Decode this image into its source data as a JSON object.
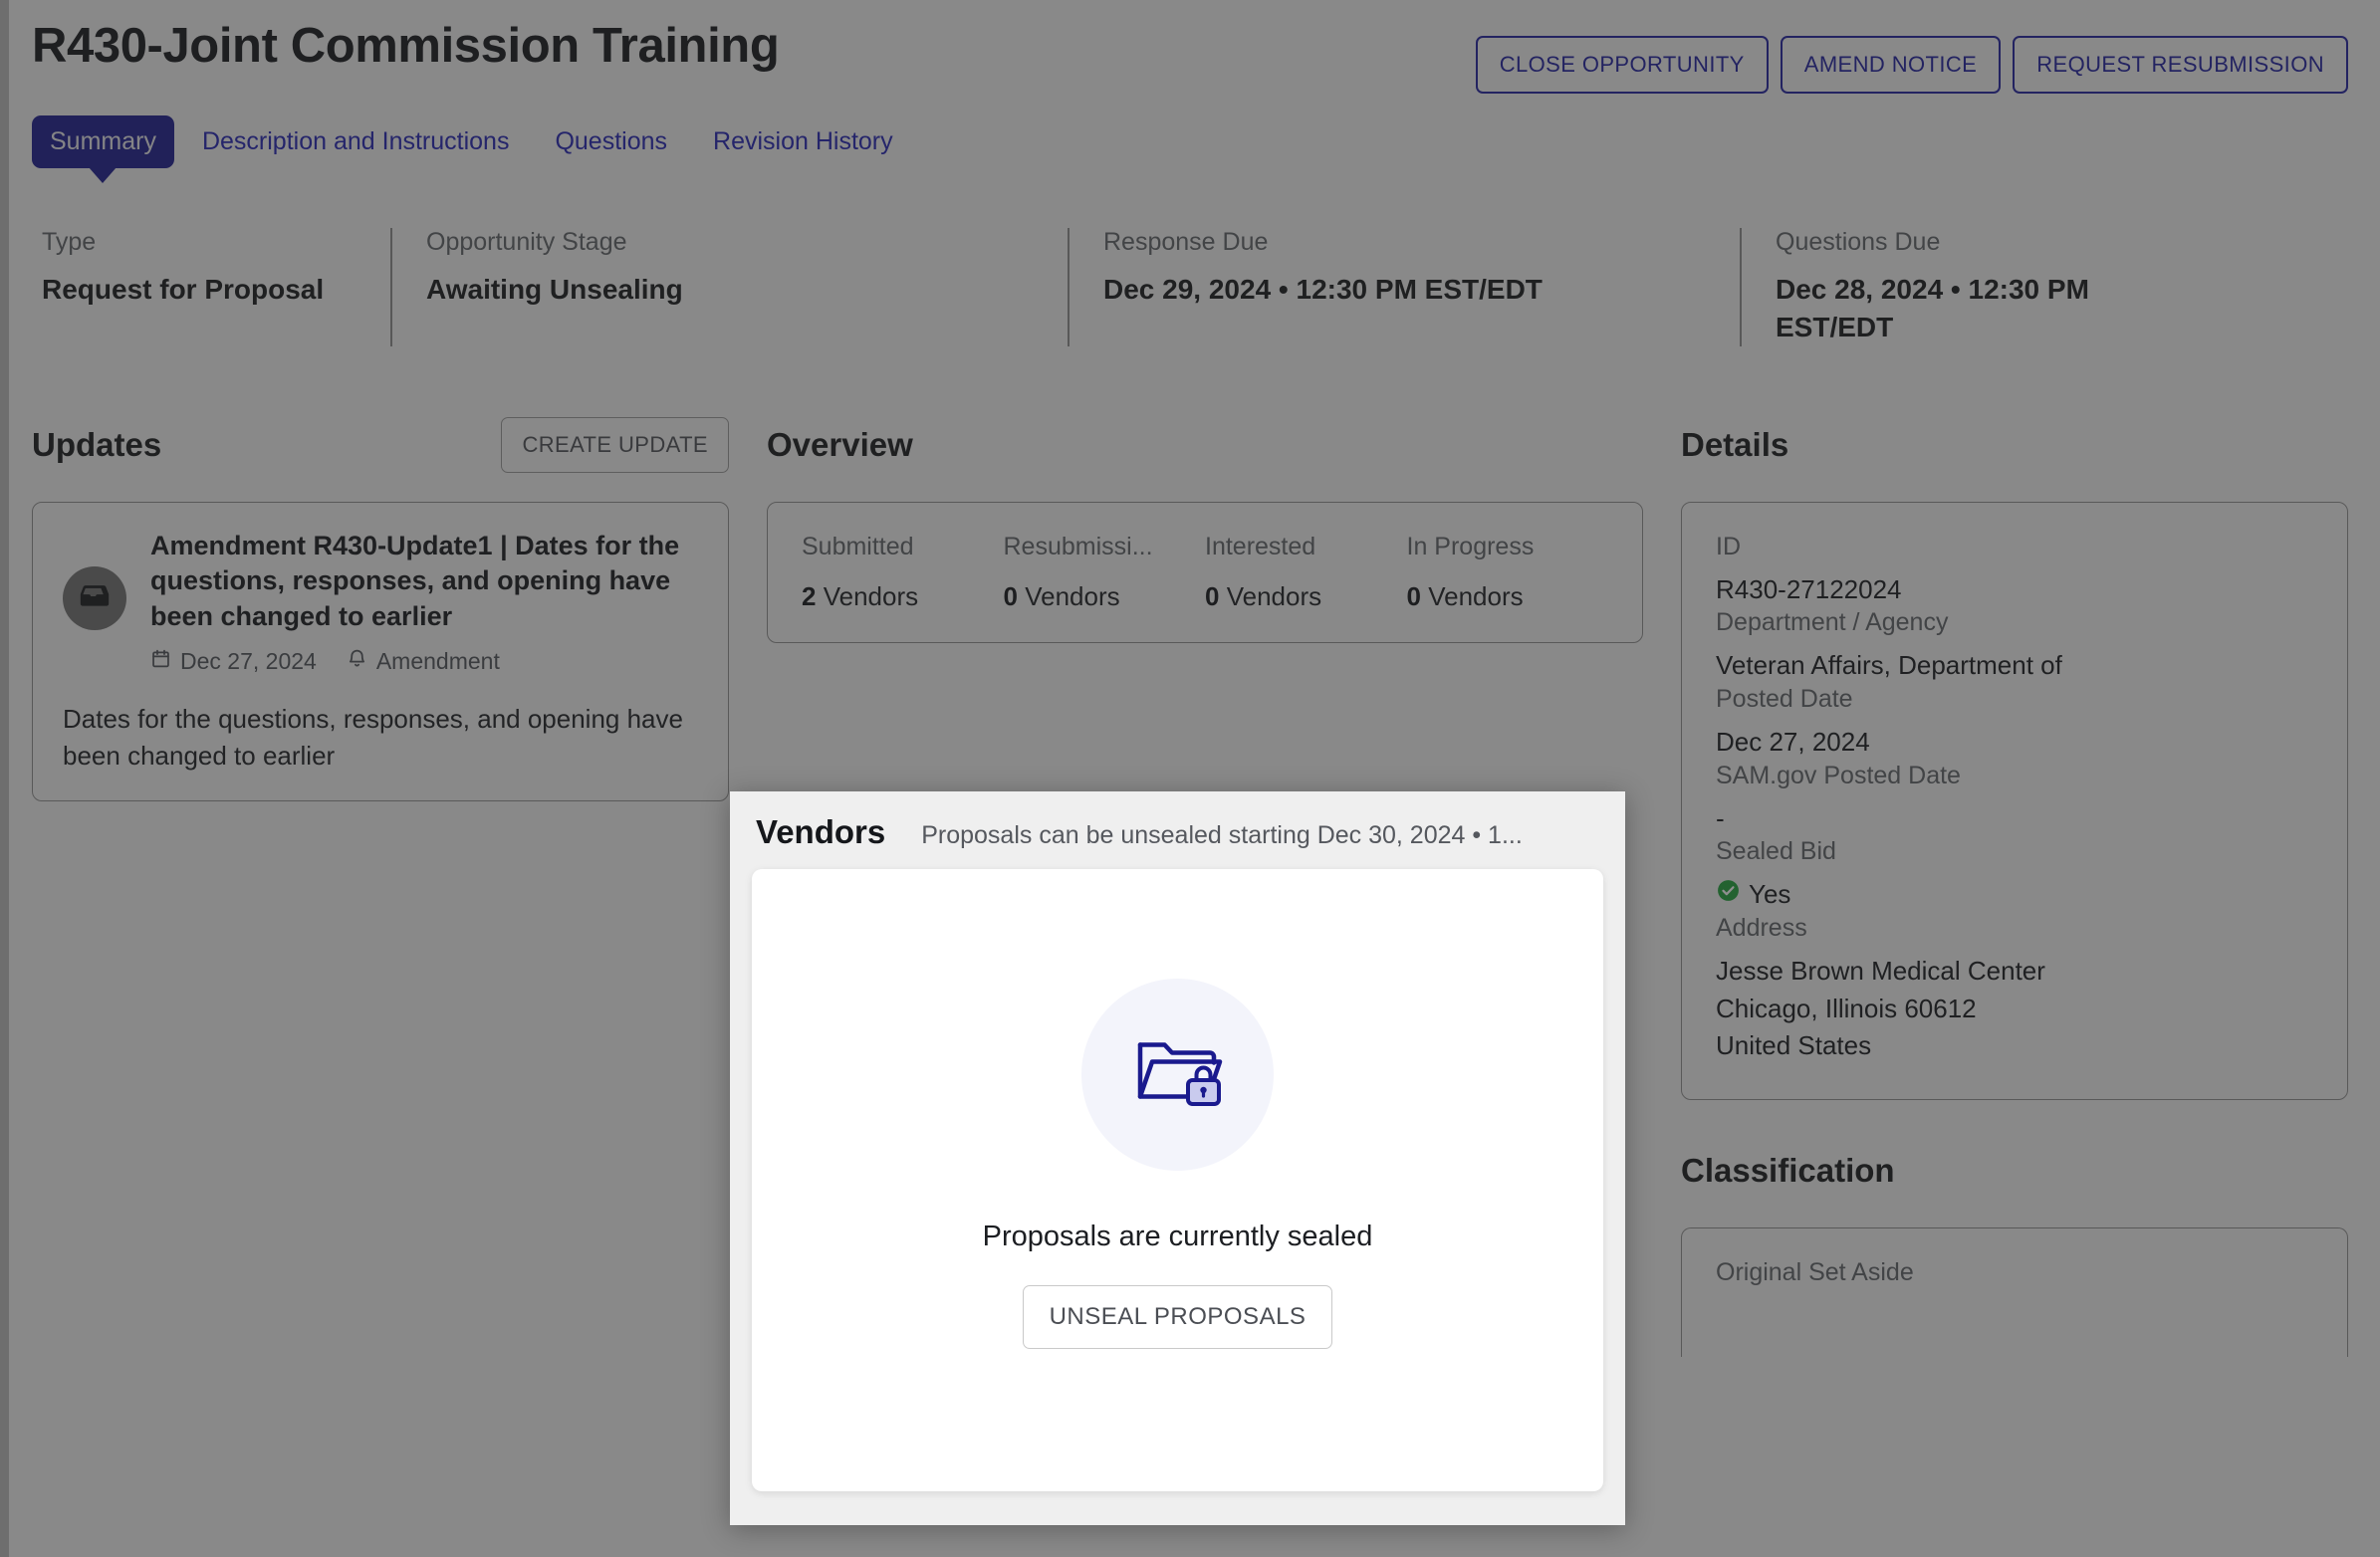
{
  "header": {
    "title": "R430-Joint Commission Training",
    "actions": [
      {
        "label": "CLOSE OPPORTUNITY",
        "name": "close-opportunity-button"
      },
      {
        "label": "AMEND NOTICE",
        "name": "amend-notice-button"
      },
      {
        "label": "REQUEST RESUBMISSION",
        "name": "request-resubmission-button"
      }
    ]
  },
  "tabs": [
    {
      "label": "Summary",
      "active": true
    },
    {
      "label": "Description and Instructions",
      "active": false
    },
    {
      "label": "Questions",
      "active": false
    },
    {
      "label": "Revision History",
      "active": false
    }
  ],
  "info_strip": [
    {
      "label": "Type",
      "value": "Request for Proposal"
    },
    {
      "label": "Opportunity Stage",
      "value": "Awaiting Unsealing"
    },
    {
      "label": "Response Due",
      "value": "Dec 29, 2024 • 12:30 PM EST/EDT"
    },
    {
      "label": "Questions Due",
      "value": "Dec 28, 2024 • 12:30 PM EST/EDT"
    }
  ],
  "updates": {
    "title": "Updates",
    "create_label": "CREATE UPDATE",
    "items": [
      {
        "icon": "inbox-icon",
        "title": "Amendment R430-Update1 | Dates for the questions, responses, and opening have been changed to earlier",
        "date": "Dec 27, 2024",
        "tag": "Amendment",
        "body": "Dates for the questions, responses, and opening have been changed to earlier"
      }
    ]
  },
  "overview": {
    "title": "Overview",
    "stats": [
      {
        "label": "Submitted",
        "count": "2",
        "unit": "Vendors"
      },
      {
        "label": "Resubmissi...",
        "count": "0",
        "unit": "Vendors"
      },
      {
        "label": "Interested",
        "count": "0",
        "unit": "Vendors"
      },
      {
        "label": "In Progress",
        "count": "0",
        "unit": "Vendors"
      }
    ]
  },
  "vendors_modal": {
    "title": "Vendors",
    "subtitle": "Proposals can be unsealed starting Dec 30, 2024 • 1...",
    "sealed_message": "Proposals are currently sealed",
    "unseal_label": "UNSEAL PROPOSALS",
    "icon": "folder-lock-icon"
  },
  "details": {
    "title": "Details",
    "fields": [
      {
        "label": "ID",
        "value": "R430-27122024"
      },
      {
        "label": "Department / Agency",
        "value": "Veteran Affairs, Department of"
      },
      {
        "label": "Posted Date",
        "value": "Dec 27, 2024"
      },
      {
        "label": "SAM.gov Posted Date",
        "value": "-"
      },
      {
        "label": "Sealed Bid",
        "value": "Yes"
      },
      {
        "label": "Address",
        "value": "Jesse Brown Medical Center\nChicago, Illinois 60612\nUnited States"
      }
    ]
  },
  "classification": {
    "title": "Classification",
    "fields": [
      {
        "label": "Original Set Aside",
        "value": ""
      }
    ]
  },
  "colors": {
    "accent": "#1a1a8e",
    "link": "#2323b3",
    "success": "#1fa13a",
    "page_bg": "#f3f3f3"
  }
}
